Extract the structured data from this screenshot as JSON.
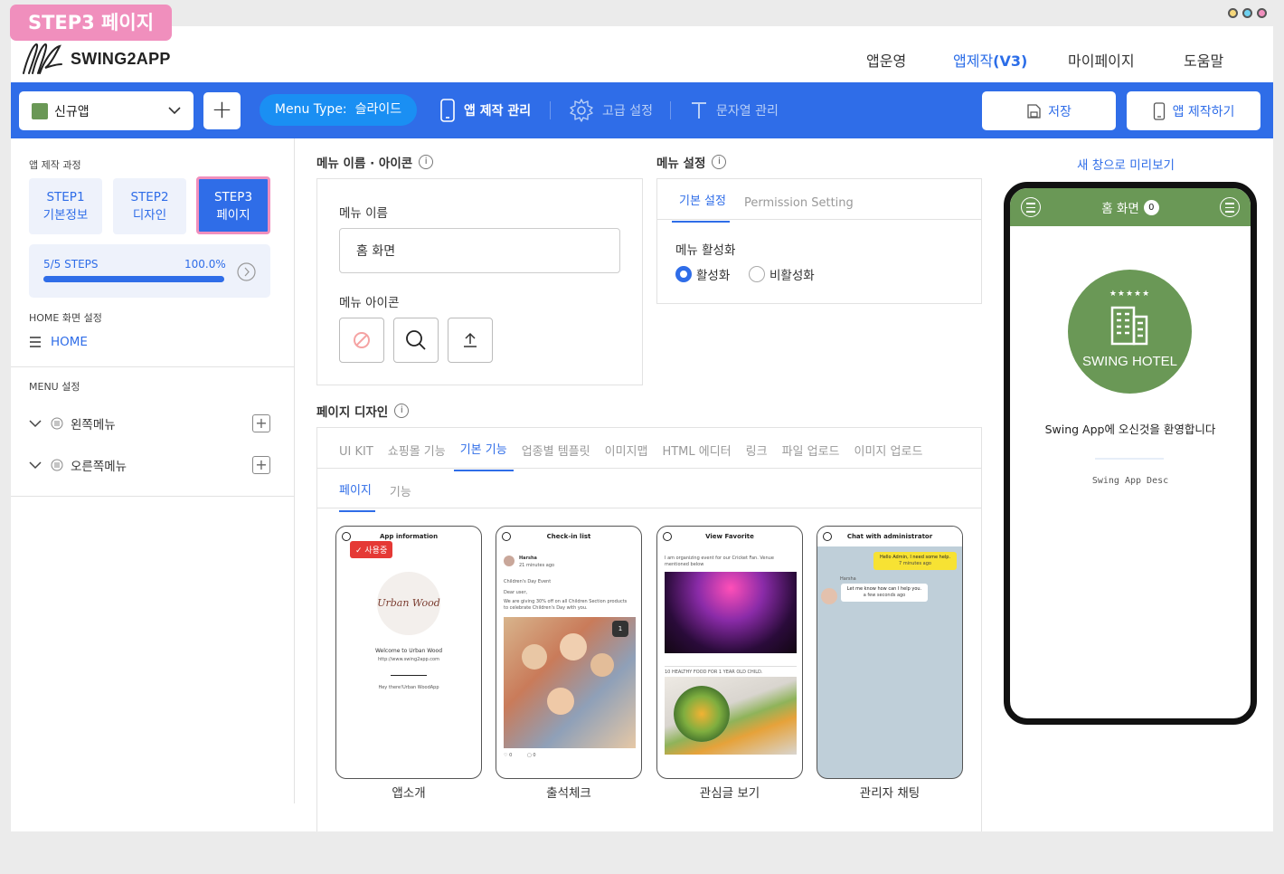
{
  "step_badge": "STEP3 페이지",
  "brand": {
    "name": "SWING2APP"
  },
  "top_nav": [
    {
      "label": "앱운영"
    },
    {
      "label_prefix": "앱제작",
      "label_suffix": "(V3)"
    },
    {
      "label": "마이페이지"
    },
    {
      "label": "도움말"
    }
  ],
  "toolbar": {
    "app_select": "신규앱",
    "add": "+",
    "menu_type_label": "Menu Type:",
    "menu_type_value": "슬라이드",
    "app_manage": "앱 제작 관리",
    "advanced": "고급 설정",
    "strings": "문자열 관리",
    "save": "저장",
    "build": "앱 제작하기"
  },
  "sidebar": {
    "process_label": "앱 제작 과정",
    "steps": [
      {
        "line1": "STEP1",
        "line2": "기본정보"
      },
      {
        "line1": "STEP2",
        "line2": "디자인"
      },
      {
        "line1": "STEP3",
        "line2": "페이지"
      }
    ],
    "progress_text": "5/5 STEPS",
    "progress_percent": "100.0%",
    "progress_fraction": 1.0,
    "home_label": "HOME 화면 설정",
    "home_item": "HOME",
    "menu_label": "MENU 설정",
    "menu_items": [
      {
        "label": "왼쪽메뉴"
      },
      {
        "label": "오른쪽메뉴"
      }
    ]
  },
  "menu_name_icon": {
    "title": "메뉴 이름 · 아이콘",
    "name_label": "메뉴 이름",
    "name_value": "홈 화면",
    "icon_label": "메뉴 아이콘"
  },
  "menu_settings": {
    "title": "메뉴 설정",
    "tabs": [
      "기본 설정",
      "Permission Setting"
    ],
    "activation_label": "메뉴 활성화",
    "options": [
      "활성화",
      "비활성화"
    ]
  },
  "page_design": {
    "title": "페이지 디자인",
    "tabs": [
      "UI KIT",
      "쇼핑몰 기능",
      "기본 기능",
      "업종별 템플릿",
      "이미지맵",
      "HTML 에디터",
      "링크",
      "파일 업로드",
      "이미지 업로드"
    ],
    "sub_tabs": [
      "페이지",
      "기능"
    ],
    "cards": [
      {
        "caption": "앱소개",
        "header": "App information",
        "badge": "✓ 사용중",
        "logo_text": "Urban Wood",
        "welcome": "Welcome to Urban Wood",
        "url": "http://www.swing2app.com",
        "sub": "Hey there!Urban WoodApp"
      },
      {
        "caption": "출석체크",
        "header": "Check-in list",
        "user": "Harsha",
        "time": "21 minutes ago",
        "event": "Children's Day Event",
        "body1": "Dear user,",
        "body2": "We are giving 30% off on all Children Section products to celebrate Children's Day with you.",
        "count": "1",
        "likes": "♡ 0",
        "comments": "▢ 0"
      },
      {
        "caption": "관심글 보기",
        "header": "View Favorite",
        "text1": "I am organizing event for our Cricket Fan. Venue mentioned below",
        "text2": "10 HEALTHY FOOD FOR 1 YEAR OLD CHILD."
      },
      {
        "caption": "관리자 채팅",
        "header": "Chat with administrator",
        "msg1": "Hello Admin, I need some help.",
        "msg1_time": "7 minutes ago",
        "user": "Harsha",
        "msg2": "Let me know how can I help you.",
        "msg2_time": "a few seconds ago"
      }
    ]
  },
  "preview": {
    "link": "새 창으로 미리보기",
    "title": "홈 화면",
    "badge_count": "0",
    "hotel_name": "SWING HOTEL",
    "welcome": "Swing App에 오신것을 환영합니다",
    "desc": "Swing App Desc"
  },
  "colors": {
    "primary": "#2f6de8",
    "pink": "#f08fbd",
    "hotel_green": "#6a9856",
    "menu_type_blue": "#1a8ff3"
  }
}
